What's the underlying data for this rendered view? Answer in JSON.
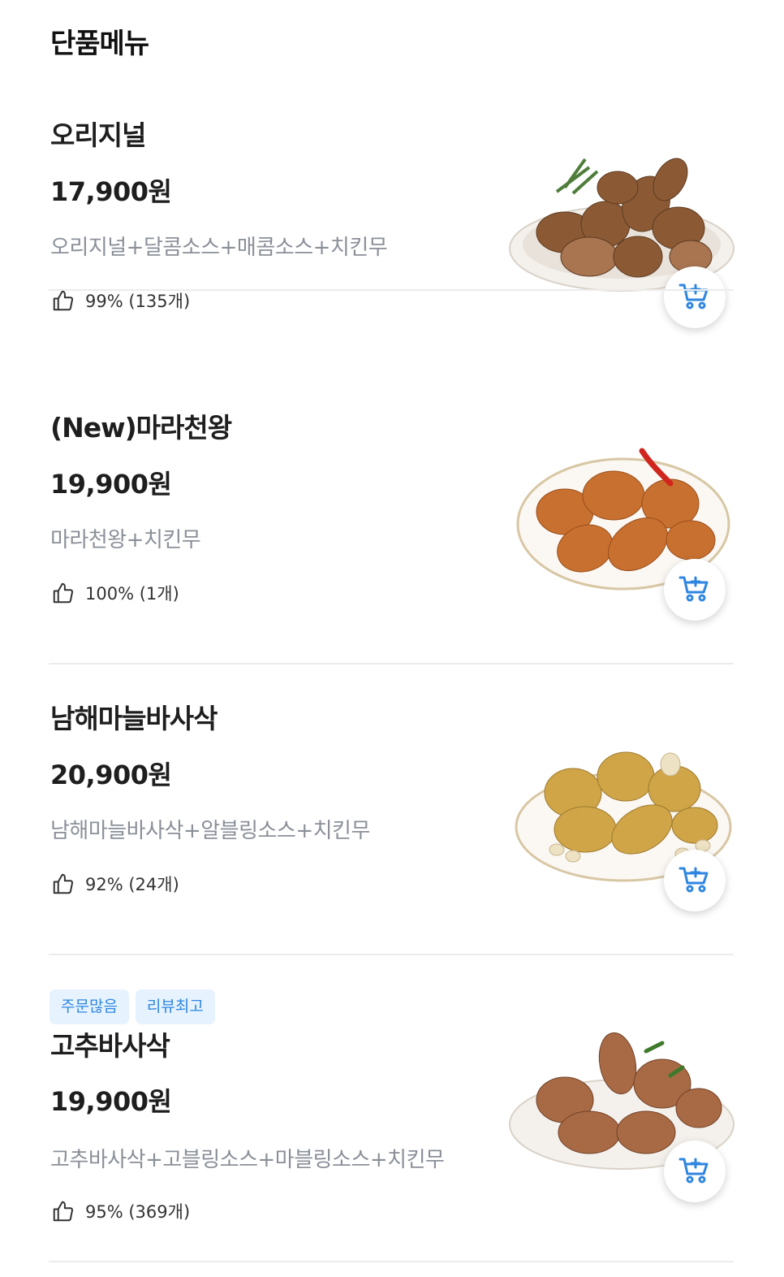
{
  "section": {
    "title": "단품메뉴"
  },
  "items": [
    {
      "name": "오리지널",
      "price": "17,900원",
      "description": "오리지널+달콤소스+매콤소스+치킨무",
      "rating": "99% (135개)",
      "badges": [],
      "image": "roasted-chicken-photo"
    },
    {
      "name": "(New)마라천왕",
      "price": "19,900원",
      "description": "마라천왕+치킨무",
      "rating": "100% (1개)",
      "badges": [],
      "image": "mala-chicken-photo"
    },
    {
      "name": "남해마늘바사삭",
      "price": "20,900원",
      "description": "남해마늘바사삭+알블링소스+치킨무",
      "rating": "92% (24개)",
      "badges": [],
      "image": "garlic-chicken-photo"
    },
    {
      "name": "고추바사삭",
      "price": "19,900원",
      "description": "고추바사삭+고블링소스+마블링소스+치킨무",
      "rating": "95% (369개)",
      "badges": [
        "주문많음",
        "리뷰최고"
      ],
      "image": "pepper-chicken-photo"
    }
  ],
  "colors": {
    "accent": "#2f86e0",
    "badge_bg": "#e6f3ff",
    "description": "#8a8f98",
    "divider": "#ececec"
  },
  "icons": {
    "rating": "thumbs-up-icon",
    "cart": "add-to-cart-icon"
  }
}
